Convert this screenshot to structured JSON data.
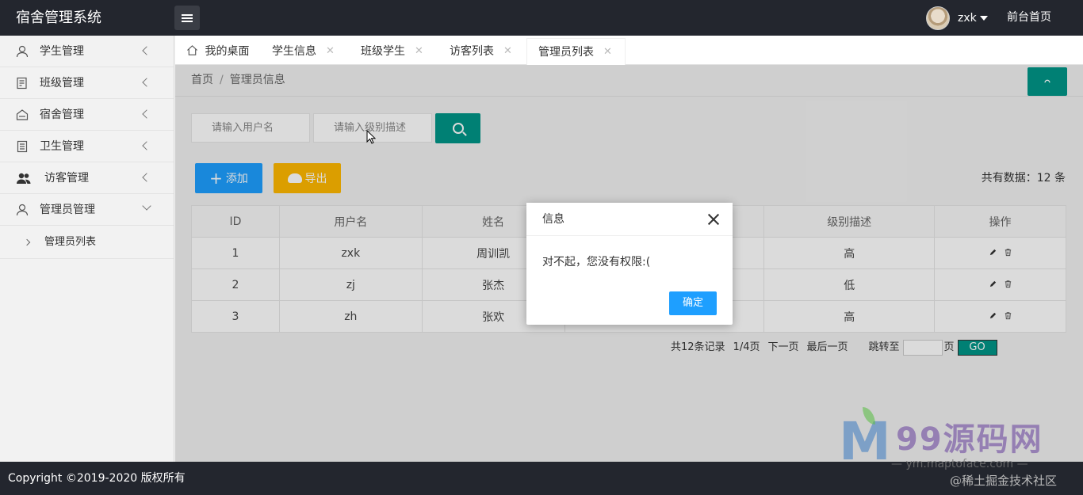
{
  "app": {
    "title": "宿舍管理系统"
  },
  "header": {
    "username": "zxk",
    "front_link": "前台首页"
  },
  "sidebar": {
    "items": [
      {
        "label": "学生管理",
        "icon": "user-icon"
      },
      {
        "label": "班级管理",
        "icon": "document-icon"
      },
      {
        "label": "宿舍管理",
        "icon": "dorm-icon"
      },
      {
        "label": "卫生管理",
        "icon": "clipboard-icon"
      },
      {
        "label": "访客管理",
        "icon": "users-icon"
      },
      {
        "label": "管理员管理",
        "icon": "admin-icon",
        "expanded": true
      }
    ],
    "sub_items": [
      {
        "label": "管理员列表"
      }
    ]
  },
  "tabs": [
    {
      "label": "我的桌面",
      "icon": "home-icon",
      "closable": false
    },
    {
      "label": "学生信息",
      "closable": true
    },
    {
      "label": "班级学生",
      "closable": true
    },
    {
      "label": "访客列表",
      "closable": true
    },
    {
      "label": "管理员列表",
      "closable": true,
      "active": true
    }
  ],
  "breadcrumb": {
    "home": "首页",
    "separator": "/",
    "current": "管理员信息"
  },
  "search": {
    "username_placeholder": "请输入用户名",
    "level_placeholder": "请输入级别描述"
  },
  "toolbar": {
    "add_label": "添加",
    "export_label": "导出",
    "total_label": "共有数据：",
    "total_count": "12",
    "total_unit": "条"
  },
  "table": {
    "headers": [
      "ID",
      "用户名",
      "姓名",
      "",
      "级别描述",
      "操作"
    ],
    "rows": [
      {
        "id": "1",
        "username": "zxk",
        "name": "周训凯",
        "level": "高"
      },
      {
        "id": "2",
        "username": "zj",
        "name": "张杰",
        "level": "低"
      },
      {
        "id": "3",
        "username": "zh",
        "name": "张欢",
        "level": "高"
      }
    ]
  },
  "pager": {
    "records": "共12条记录",
    "page": "1/4页",
    "next": "下一页",
    "last": "最后一页",
    "jump_to": "跳转至",
    "page_unit": "页",
    "go": "GO"
  },
  "dialog": {
    "title": "信息",
    "message": "对不起，您没有权限:(",
    "ok_label": "确定"
  },
  "footer": {
    "copyright": "Copyright ©2019-2020 版权所有"
  },
  "watermark": {
    "brand": "99源码网",
    "url": "— ym.maptoface.com —",
    "credit": "@稀土掘金技术社区"
  },
  "colors": {
    "header_bg": "#23262e",
    "primary_green": "#009688",
    "primary_blue": "#1e9fff",
    "warm_yellow": "#ffb800"
  }
}
